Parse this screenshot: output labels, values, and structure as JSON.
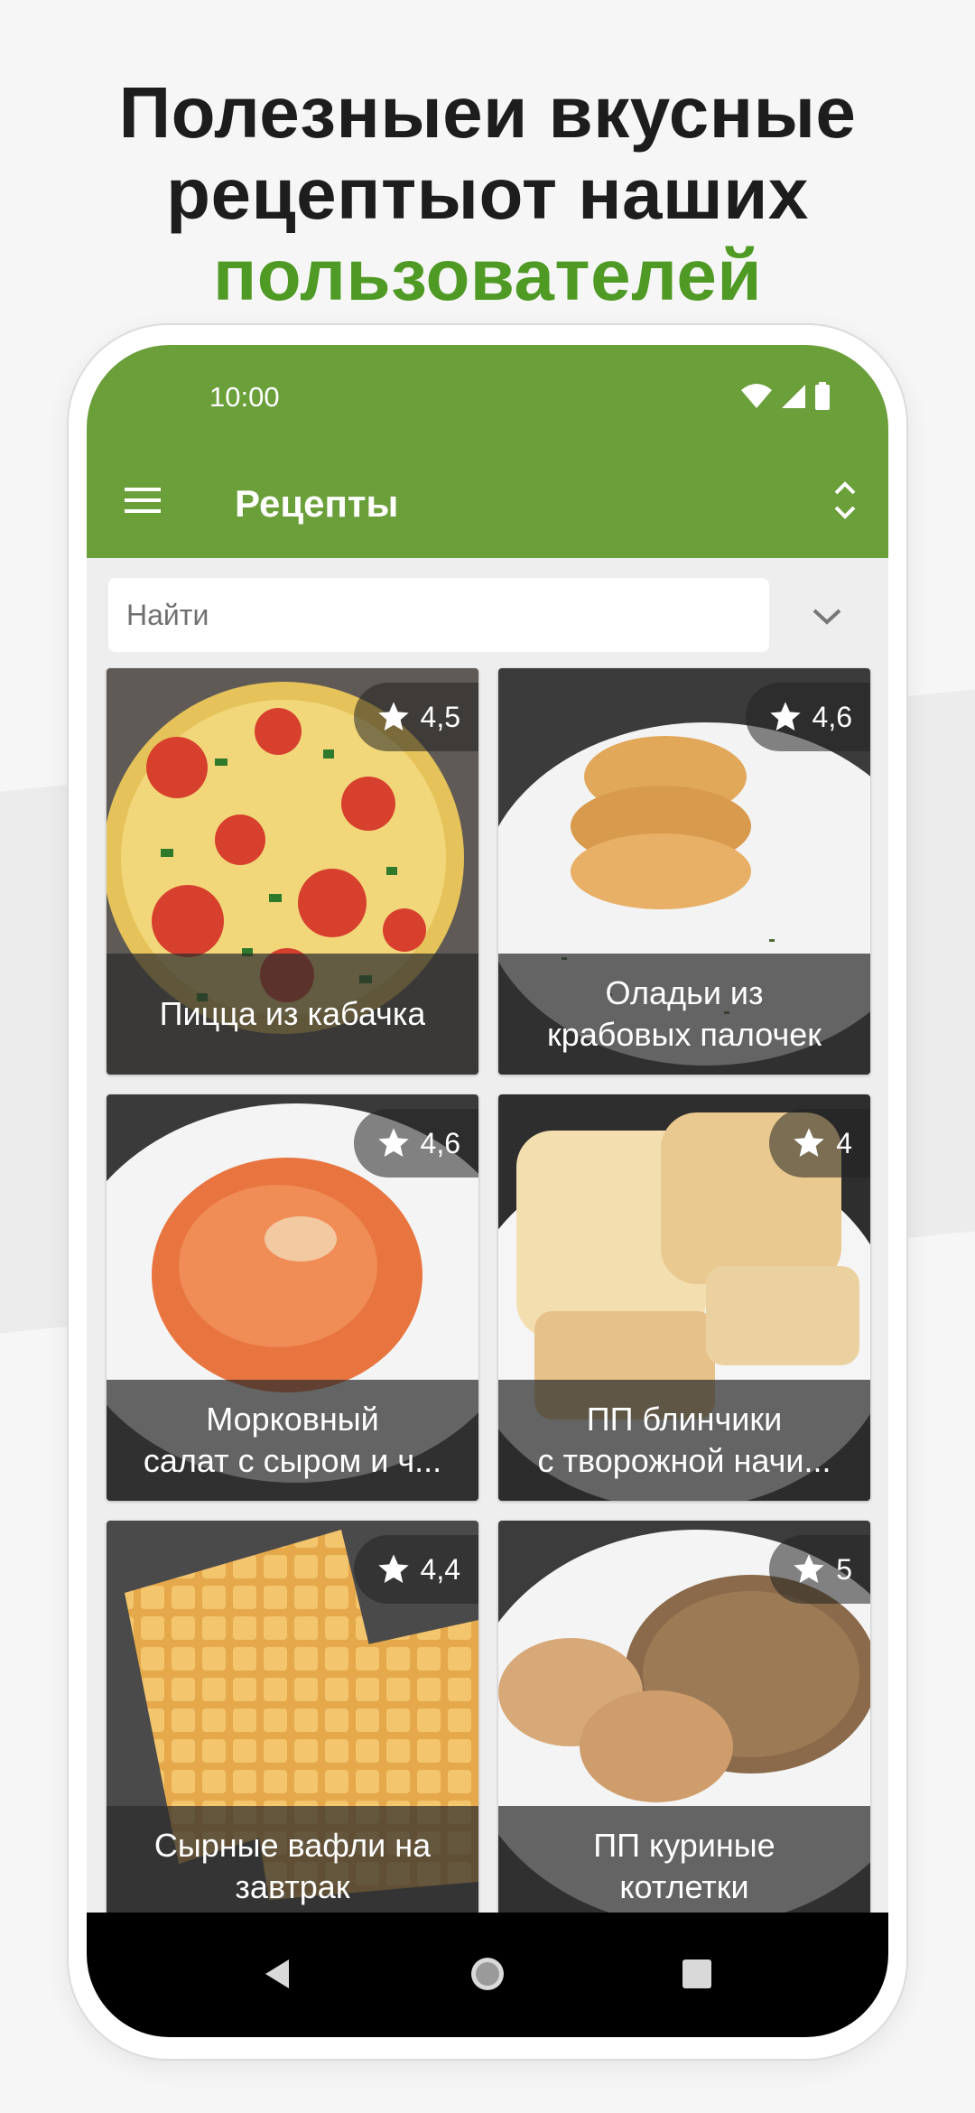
{
  "promo": {
    "line1": "Полезныеи вкусные",
    "line2": "рецептыот наших",
    "accent": "пользователей",
    "accent_color": "#4f9a24"
  },
  "status_bar": {
    "time": "10:00",
    "icons": [
      "wifi-icon",
      "signal-icon",
      "battery-icon"
    ]
  },
  "toolbar": {
    "title": "Рецепты",
    "menu_icon": "hamburger-menu-icon",
    "sort_icon": "unfold-more-icon",
    "color": "#6a9f3a"
  },
  "search": {
    "placeholder": "Найти",
    "value": "",
    "dropdown_icon": "chevron-down-icon"
  },
  "recipes": [
    {
      "title_lines": [
        "Пицца из кабачка"
      ],
      "rating": "4,5"
    },
    {
      "title_lines": [
        "Оладьи из",
        "крабовых палочек"
      ],
      "rating": "4,6"
    },
    {
      "title_lines": [
        "Морковный",
        "салат с сыром и ч..."
      ],
      "rating": "4,6"
    },
    {
      "title_lines": [
        "ПП блинчики",
        "с творожной начи..."
      ],
      "rating": "4"
    },
    {
      "title_lines": [
        "Сырные вафли на",
        "завтрак"
      ],
      "rating": "4,4"
    },
    {
      "title_lines": [
        "ПП куриные",
        "котлетки"
      ],
      "rating": "5"
    }
  ],
  "nav": {
    "back_icon": "back-triangle-icon",
    "home_icon": "home-circle-icon",
    "recents_icon": "recents-square-icon"
  }
}
